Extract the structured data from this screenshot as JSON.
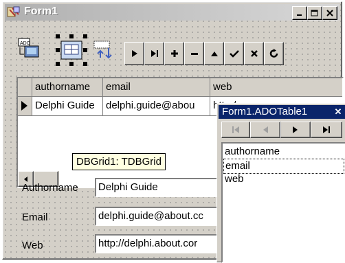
{
  "window": {
    "title": "Form1"
  },
  "toolbar": {
    "components": [
      "ado-connection-icon",
      "db-grid-icon",
      "db-navigator-icon"
    ],
    "nav_buttons": [
      "first-icon",
      "last-icon",
      "insert-icon",
      "delete-icon",
      "edit-icon",
      "post-icon",
      "cancel-icon",
      "refresh-icon"
    ]
  },
  "grid": {
    "columns": [
      "authorname",
      "email",
      "web"
    ],
    "row": [
      "Delphi Guide",
      "delphi.guide@abou",
      "http:/"
    ],
    "tooltip": "DBGrid1: TDBGrid"
  },
  "fields": [
    {
      "label": "Authorname",
      "value": "Delphi Guide"
    },
    {
      "label": "Email",
      "value": "delphi.guide@about.cc"
    },
    {
      "label": "Web",
      "value": "http://delphi.about.cor"
    }
  ],
  "fields_editor": {
    "title": "Form1.ADOTable1",
    "close": "✕",
    "items": [
      "authorname",
      "email",
      "web"
    ]
  },
  "colors": {
    "active_title": "#0a246a",
    "face": "#d4d0c8",
    "tooltip_bg": "#ffffe1"
  }
}
